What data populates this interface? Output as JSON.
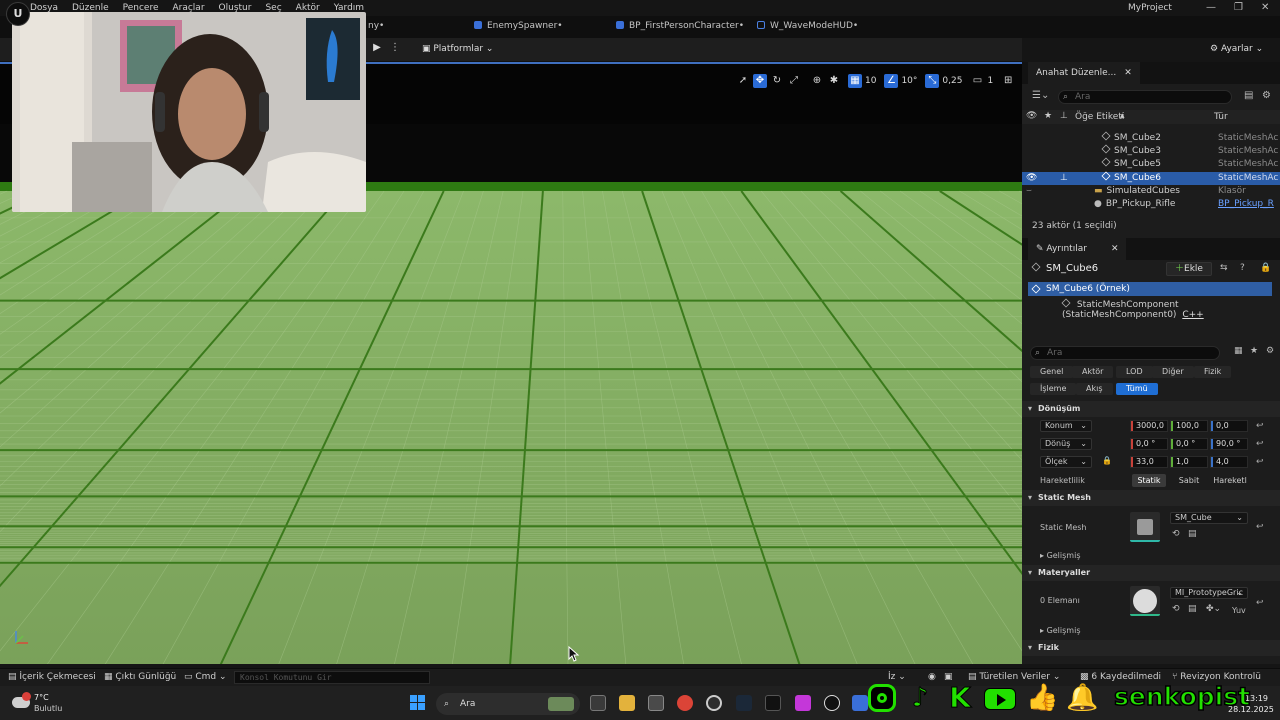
{
  "app": {
    "project_name": "MyProject",
    "menu": [
      "Dosya",
      "Düzenle",
      "Pencere",
      "Araçlar",
      "Oluştur",
      "Seç",
      "Aktör",
      "Yardım"
    ],
    "logo_letter": "U"
  },
  "tabs": [
    {
      "label": "ny•",
      "color": "#3a6fd8"
    },
    {
      "label": "EnemySpawner•",
      "color": "#3a6fd8"
    },
    {
      "label": "BP_FirstPersonCharacter•",
      "color": "#3a6fd8"
    },
    {
      "label": "W_WaveModeHUD•",
      "color": "#3a6fd8"
    }
  ],
  "toolbar": {
    "platforms_label": "Platformlar",
    "settings_label": "Ayarlar"
  },
  "viewport_toolbar": {
    "grid_snap": "10",
    "rotation_snap": "10°",
    "scale_snap": "0,25",
    "camera_speed": "1"
  },
  "outliner": {
    "tab_label": "Anahat Düzenle...",
    "search_placeholder": "Ara",
    "col_label": "Öğe Etiketi",
    "col_type": "Tür",
    "rows": [
      {
        "name": "SM_Cube2",
        "type": "StaticMeshAc"
      },
      {
        "name": "SM_Cube3",
        "type": "StaticMeshAc"
      },
      {
        "name": "SM_Cube5",
        "type": "StaticMeshAc"
      },
      {
        "name": "SM_Cube6",
        "type": "StaticMeshAc"
      },
      {
        "name": "SimulatedCubes",
        "type": "Klasör"
      },
      {
        "name": "BP_Pickup_Rifle",
        "type": "BP_Pickup_R"
      }
    ],
    "footer": "23 aktör (1 seçildi)"
  },
  "details": {
    "tab_label": "Ayrıntılar",
    "actor_name": "SM_Cube6",
    "add_label": "Ekle",
    "instance_label": "SM_Cube6 (Örnek)",
    "component_label": "StaticMeshComponent (StaticMeshComponent0)",
    "component_link": "C++",
    "search_placeholder": "Ara",
    "filters_row1": [
      "Genel",
      "Aktör",
      "LOD",
      "Diğer",
      "Fizik"
    ],
    "filters_row2": [
      "İşleme",
      "Akış",
      "Tümü"
    ],
    "transform": {
      "section": "Dönüşüm",
      "location_label": "Konum",
      "location": [
        "3000,0",
        "100,0",
        "0,0"
      ],
      "rotation_label": "Dönüş",
      "rotation": [
        "0,0 °",
        "0,0 °",
        "90,0 °"
      ],
      "scale_label": "Ölçek",
      "scale": [
        "33,0",
        "1,0",
        "4,0"
      ],
      "mobility_label": "Hareketlilik",
      "mobility": [
        "Statik",
        "Sabit",
        "Hareketl"
      ]
    },
    "static_mesh": {
      "section": "Static Mesh",
      "label": "Static Mesh",
      "value": "SM_Cube",
      "advanced": "Gelişmiş"
    },
    "materials": {
      "section": "Materyaller",
      "label": "0 Elemanı",
      "value": "MI_PrototypeGric",
      "extra": "Yuv",
      "advanced": "Gelişmiş"
    },
    "physics_section": "Fizik"
  },
  "bottombar": {
    "content_drawer": "İçerik Çekmecesi",
    "output_log": "Çıktı Günlüğü",
    "cmd": "Cmd",
    "console_placeholder": "Konsol Komutunu Gir",
    "iz": "İz",
    "derived": "Türetilen Veriler",
    "saved": "6 Kaydedilmedi",
    "revision": "Revizyon Kontrolü"
  },
  "taskbar": {
    "temperature": "7°C",
    "weather": "Bulutlu",
    "search_label": "Ara",
    "time": "13:19",
    "date": "28.12.2025"
  },
  "overlay": {
    "brand": "senkopist"
  },
  "colors": {
    "accent_blue": "#2a5ca8",
    "floor_green": "#7aa25c",
    "grid_dark": "#3c7a1e",
    "brand_green": "#22e000"
  }
}
